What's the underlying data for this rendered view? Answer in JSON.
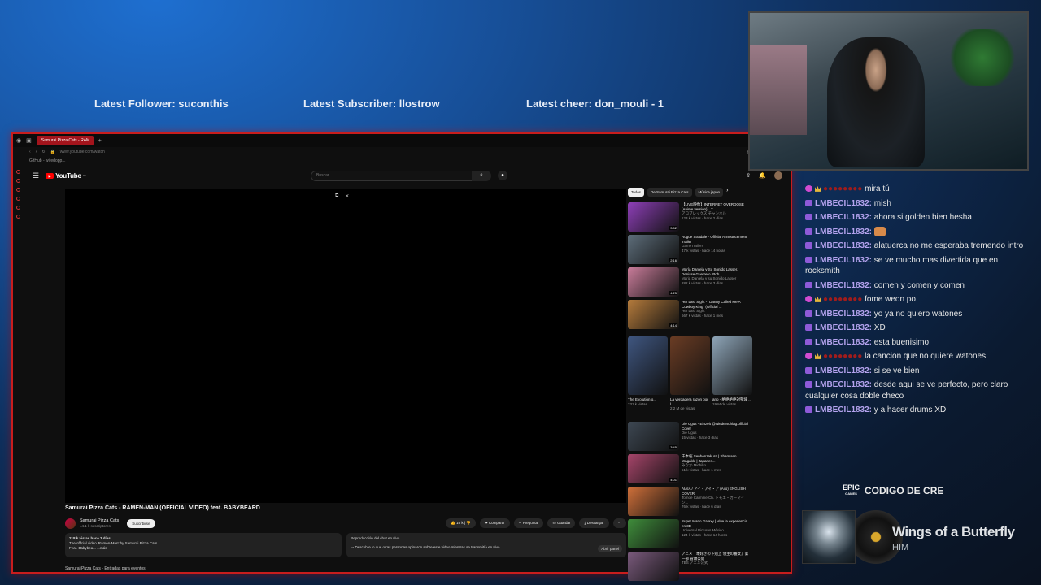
{
  "banners": {
    "follower": "Latest Follower: suconthis",
    "subscriber": "Latest Subscriber: llostrow",
    "cheer": "Latest cheer: don_mouli - 1"
  },
  "browser": {
    "tab_title": "Samurai Pizza Cats - RAM",
    "url": "www.youtube.com/watch",
    "bookmark": "GitHub - wiredopp..."
  },
  "youtube": {
    "logo": "YouTube",
    "logo_region": "MX",
    "search_placeholder": "Buscar",
    "video_title": "Samurai Pizza Cats - RAMEN-MAN (OFFICIAL VIDEO) feat. BABYBEARD",
    "channel": {
      "name": "Samurai Pizza Cats",
      "subscribers": "44.1 k suscriptores",
      "subscribe_label": "Suscribirse"
    },
    "actions": {
      "likes": "16 k",
      "share": "Compartir",
      "ask": "Preguntar",
      "save": "Guardar",
      "download": "Descargar"
    },
    "description": {
      "stats": "218 k vistas  hace 3 días",
      "line1": "The official video 'Ramen-Man' by Samurai Pizza Cats",
      "line2": "Feat. Babybea... ...más"
    },
    "live_chat": {
      "title": "Reproducción del chat en vivo",
      "body": "Descubre lo que otras personas opinaron sobre este video mientras se transmitía en vivo.",
      "open": "Abrir panel"
    },
    "below_title": "Samurai Pizza Cats - Entradas para eventos",
    "chips": [
      "Todos",
      "De Samurai Pizza Cats",
      "Música japon"
    ],
    "recommendations": [
      {
        "title": "【LIVE映像】INTERNET OVERDOSE (Anime version)】T...",
        "channel": "アコブレックス チャンネル",
        "meta": "123 k vistas · hace 2 días",
        "duration": "3:52",
        "color": "#8e3fb8"
      },
      {
        "title": "Rogue Stradale - Official Announcement Trailer",
        "channel": "GameTrailers",
        "meta": "47 k vistas · hace 14 horas",
        "duration": "2:16",
        "color": "#5d6d7a"
      },
      {
        "title": "María Daniela y Su Sonido Lasser, Denisse Guerrero -Pob...",
        "channel": "Maria Daniela y su Sonido Lasser",
        "meta": "282 k vistas · hace 3 días",
        "duration": "4:25",
        "color": "#c97c9a"
      },
      {
        "title": "Her Last Sight - \"Danny Called Me A Cowboy King\" (Official ...",
        "channel": "Her Last Sight",
        "meta": "667 k vistas · hace 1 mes",
        "duration": "4:14",
        "color": "#b57b3c"
      }
    ],
    "shorts": [
      {
        "title": "The Evolution o...",
        "views": "231 k vistas",
        "color": "#3f5680"
      },
      {
        "title": "La verdadera razón por l...",
        "views": "2.2 M de vistas",
        "color": "#6a3c24"
      },
      {
        "title": "ano - 絶絶絶絶対聖域 ...",
        "views": "19 M de vistas",
        "color": "#8ea5b8"
      }
    ],
    "more": [
      {
        "title": "Die Ugus - Einzeit @Niederschlag.official Cover",
        "channel": "Die Ugus",
        "meta": "15 vistas · hace 3 días",
        "duration": "3:45",
        "color": "#3d4752"
      },
      {
        "title": "千本桜 Senbonzakura | Shamisen | Wagakki | Japanes...",
        "channel": "みなか Michiko",
        "meta": "51 k vistas · hace 1 mes",
        "duration": "4:01",
        "color": "#a6456a"
      },
      {
        "title": "AIAIA / アイ・アイ・ア (Aiio) ENGLISH COVER",
        "channel": "Tomoe Carmine Ch. トモエ・カーマイン...",
        "meta": "76 k vistas · hace 6 días",
        "duration": "",
        "color": "#d0703a"
      },
      {
        "title": "Super Mario Galaxy | Vive la experiencia en 3D",
        "channel": "Universal Pictures México",
        "meta": "124 k vistas · hace 14 horas",
        "duration": "",
        "color": "#3f8d3b"
      },
      {
        "title": "アニメ『本好きの下剋上 領主の養女』第一部 冒頭公開",
        "channel": "TBS アニメ公式",
        "meta": "",
        "duration": "",
        "color": "#7a5a7c"
      }
    ]
  },
  "chat": [
    {
      "user": "●●●●●●●●",
      "text": "mira tú",
      "badge": "heart",
      "hidden": true
    },
    {
      "user": "LMBECIL1832:",
      "text": "mish",
      "badge": "sub"
    },
    {
      "user": "LMBECIL1832:",
      "text": "ahora si golden bien hesha",
      "badge": "sub"
    },
    {
      "user": "LMBECIL1832:",
      "text": "",
      "badge": "sub",
      "emoji": true
    },
    {
      "user": "LMBECIL1832:",
      "text": "alatuerca no me esperaba tremendo intro",
      "badge": "sub"
    },
    {
      "user": "LMBECIL1832:",
      "text": "se ve mucho mas divertida que en rocksmith",
      "badge": "sub"
    },
    {
      "user": "LMBECIL1832:",
      "text": "comen y comen y comen",
      "badge": "sub"
    },
    {
      "user": "●●●●●●●●",
      "text": "fome weon po",
      "badge": "heart",
      "hidden": true
    },
    {
      "user": "LMBECIL1832:",
      "text": "yo ya no quiero watones",
      "badge": "sub"
    },
    {
      "user": "LMBECIL1832:",
      "text": "XD",
      "badge": "sub"
    },
    {
      "user": "LMBECIL1832:",
      "text": "esta buenisimo",
      "badge": "sub"
    },
    {
      "user": "●●●●●●●●",
      "text": "la cancion que no quiere watones",
      "badge": "heart",
      "hidden": true
    },
    {
      "user": "LMBECIL1832:",
      "text": "si se ve bien",
      "badge": "sub"
    },
    {
      "user": "LMBECIL1832:",
      "text": "desde aqui se ve perfecto, pero claro cualquier cosa doble checo",
      "badge": "sub"
    },
    {
      "user": "LMBECIL1832:",
      "text": "y a hacer drums XD",
      "badge": "sub"
    }
  ],
  "epic": {
    "logo": "EPIC",
    "logo_sub": "GAMES",
    "label": "CODIGO DE CRE"
  },
  "music": {
    "song": "Wings of a Butterfly",
    "artist": "HIM"
  }
}
